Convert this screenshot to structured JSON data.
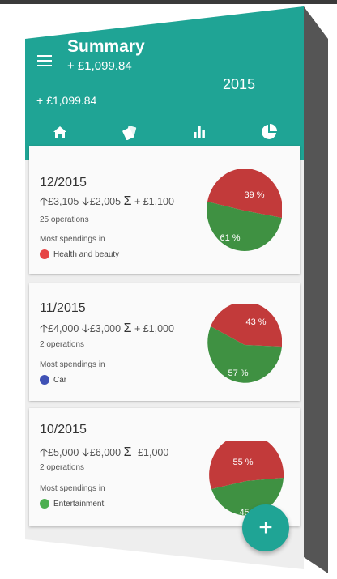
{
  "header": {
    "title": "Summary",
    "subtitle": "+ £1,099.84",
    "balance": "+ £1,099.84",
    "year": "2015",
    "tabs": [
      {
        "icon": "home-icon"
      },
      {
        "icon": "cards-icon"
      },
      {
        "icon": "bar-chart-icon"
      },
      {
        "icon": "pie-chart-icon"
      }
    ],
    "active_tab": 2
  },
  "cards": [
    {
      "month": "12/2015",
      "income": "£3,105",
      "expense": "£2,005",
      "sum": "+ £1,100",
      "operations": "25 operations",
      "most_label": "Most spendings in",
      "category": "Health and beauty",
      "category_color": "#e64545",
      "pie": {
        "red": 39,
        "green": 61,
        "red_label": "39 %",
        "green_label": "61 %"
      }
    },
    {
      "month": "11/2015",
      "income": "£4,000",
      "expense": "£3,000",
      "sum": "+ £1,000",
      "operations": "2 operations",
      "most_label": "Most spendings in",
      "category": "Car",
      "category_color": "#3f51b5",
      "pie": {
        "red": 43,
        "green": 57,
        "red_label": "43 %",
        "green_label": "57 %"
      }
    },
    {
      "month": "10/2015",
      "income": "£5,000",
      "expense": "£6,000",
      "sum": "-£1,000",
      "operations": "2 operations",
      "most_label": "Most spendings in",
      "category": "Entertainment",
      "category_color": "#4caf50",
      "pie": {
        "red": 55,
        "green": 45,
        "red_label": "55 %",
        "green_label": "45 %"
      }
    }
  ],
  "fab": {
    "label": "+"
  },
  "colors": {
    "primary": "#1fa495",
    "red": "#c23a3a",
    "green": "#3f9142"
  }
}
